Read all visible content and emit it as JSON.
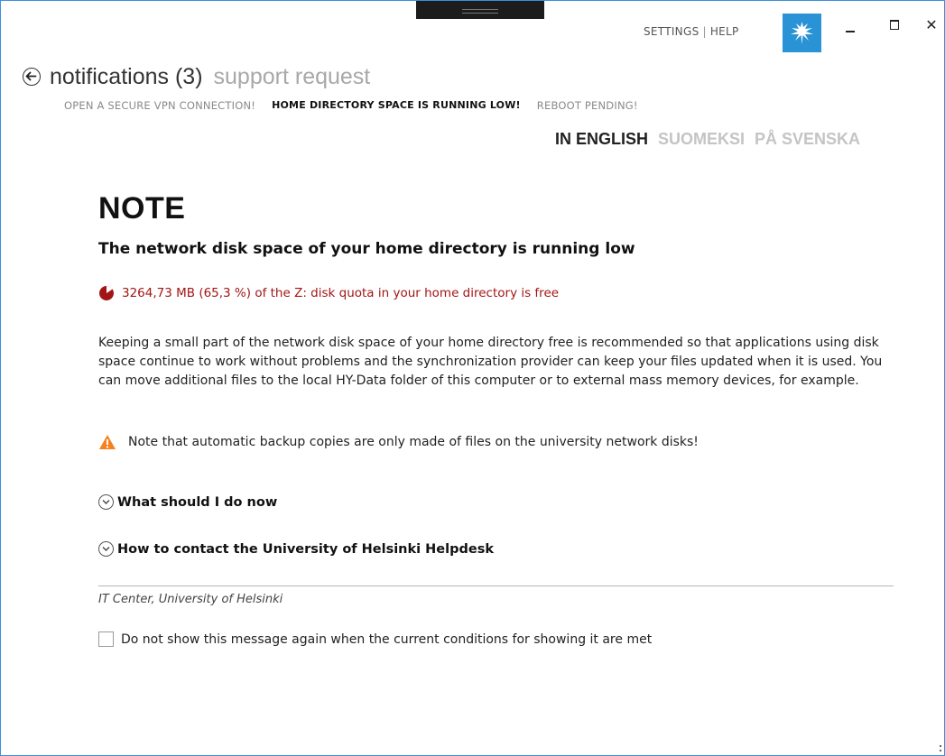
{
  "topbar": {
    "settings_label": "SETTINGS",
    "separator": "|",
    "help_label": "HELP"
  },
  "window_controls": {
    "minimize": "minimize-icon",
    "maximize": "maximize-icon",
    "close": "close-icon",
    "close_glyph": "✕"
  },
  "header": {
    "title": "notifications (3)",
    "alt_view": "support request"
  },
  "notification_tabs": [
    {
      "label": "OPEN A SECURE VPN CONNECTION!",
      "active": false
    },
    {
      "label": "HOME DIRECTORY SPACE IS RUNNING LOW!",
      "active": true
    },
    {
      "label": "REBOOT PENDING!",
      "active": false
    }
  ],
  "languages": [
    {
      "label": "IN ENGLISH",
      "active": true
    },
    {
      "label": "SUOMEKSI",
      "active": false
    },
    {
      "label": "PÅ SVENSKA",
      "active": false
    }
  ],
  "message": {
    "title": "NOTE",
    "subtitle": "The network disk space of your home directory is running low",
    "quota_text": "3264,73 MB (65,3 %) of the Z: disk quota in your home directory is free",
    "quota_used_fraction": 0.347,
    "description": "Keeping a small part of the network disk space of your home directory free is recommended so that applications using disk space continue to work without problems and the synchronization provider can keep your files updated when it is used. You can move additional files to the local HY-Data folder of this computer or to external mass memory devices, for example.",
    "warning": "Note that automatic backup copies are only made of files on the university network disks!",
    "expanders": [
      {
        "label": "What should I do now"
      },
      {
        "label": "How to contact the University of Helsinki Helpdesk"
      }
    ],
    "footer": "IT Center, University of Helsinki",
    "checkbox_label": "Do not show this message again when the current conditions for showing it are met",
    "checkbox_checked": false
  },
  "colors": {
    "accent_blue": "#2a93d5",
    "quota_red": "#a31515",
    "warning_orange": "#f5821f",
    "inactive_gray": "#c4c4c4"
  }
}
